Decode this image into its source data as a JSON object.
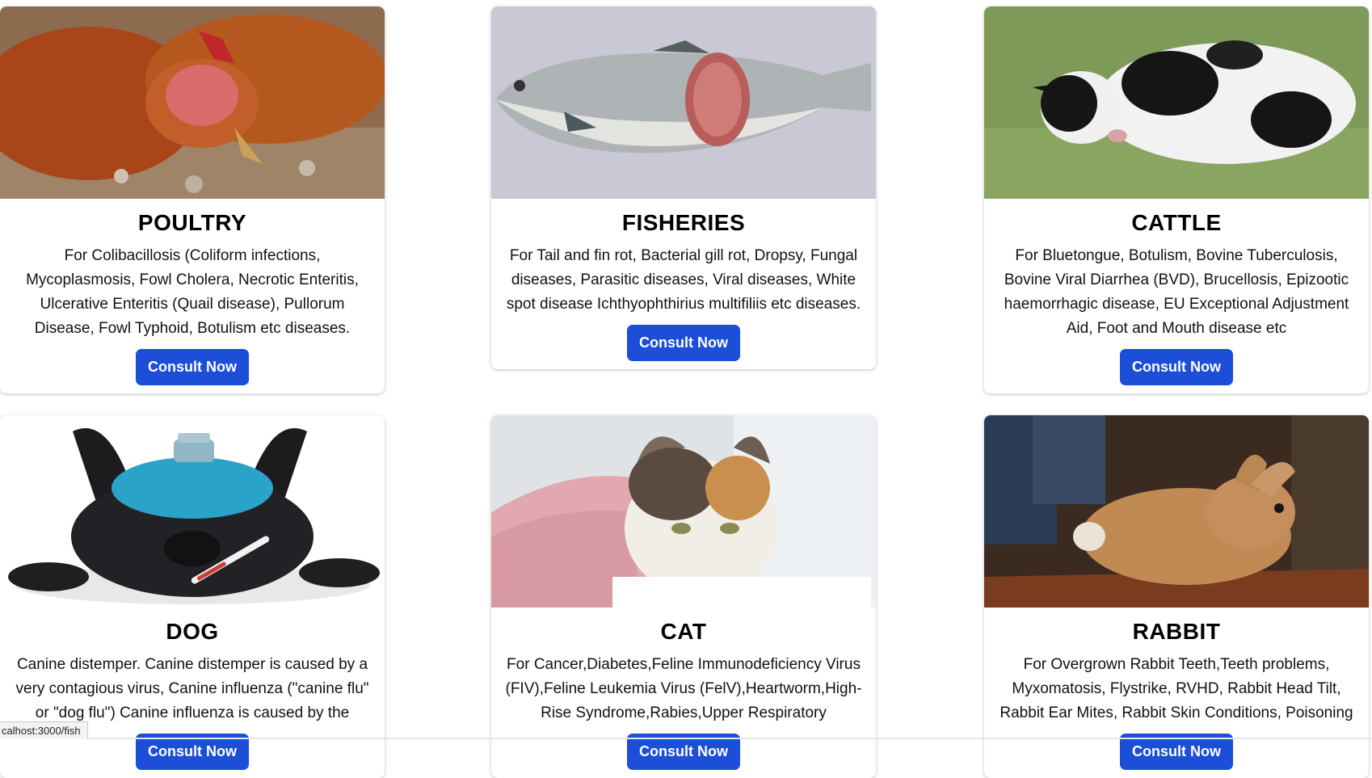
{
  "cards": [
    {
      "title": "POULTRY",
      "description": "For Colibacillosis (Coliform infections, Mycoplasmosis, Fowl Cholera, Necrotic Enteritis, Ulcerative Enteritis (Quail disease), Pullorum Disease, Fowl Typhoid, Botulism etc diseases.",
      "button": "Consult Now",
      "image": "sick-chicken-photo"
    },
    {
      "title": "FISHERIES",
      "description": "For Tail and fin rot, Bacterial gill rot, Dropsy, Fungal diseases, Parasitic diseases, Viral diseases, White spot disease Ichthyophthirius multifiliis etc diseases.",
      "button": "Consult Now",
      "image": "diseased-fish-photo"
    },
    {
      "title": "CATTLE",
      "description": "For Bluetongue, Botulism, Bovine Tuberculosis, Bovine Viral Diarrhea (BVD), Brucellosis, Epizootic haemorrhagic disease, EU Exceptional Adjustment Aid, Foot and Mouth disease etc",
      "button": "Consult Now",
      "image": "lying-calf-photo"
    },
    {
      "title": "DOG",
      "description": "Canine distemper. Canine distemper is caused by a very contagious virus, Canine influenza (\"canine flu\" or \"dog flu\") Canine influenza is caused by the",
      "button": "Consult Now",
      "image": "sick-dog-photo"
    },
    {
      "title": "CAT",
      "description": "For Cancer,Diabetes,Feline Immunodeficiency Virus (FIV),Feline Leukemia Virus (FelV),Heartworm,High-Rise Syndrome,Rabies,Upper Respiratory",
      "button": "Consult Now",
      "image": "sick-cat-photo"
    },
    {
      "title": "RABBIT",
      "description": "For Overgrown Rabbit Teeth,Teeth problems, Myxomatosis, Flystrike, RVHD, Rabbit Head Tilt, Rabbit Ear Mites, Rabbit Skin Conditions, Poisoning",
      "button": "Consult Now",
      "image": "rabbit-photo"
    }
  ],
  "status_bar": {
    "url": "calhost:3000/fish"
  },
  "colors": {
    "button": "#1d4ed8",
    "background": "#ffffff"
  }
}
